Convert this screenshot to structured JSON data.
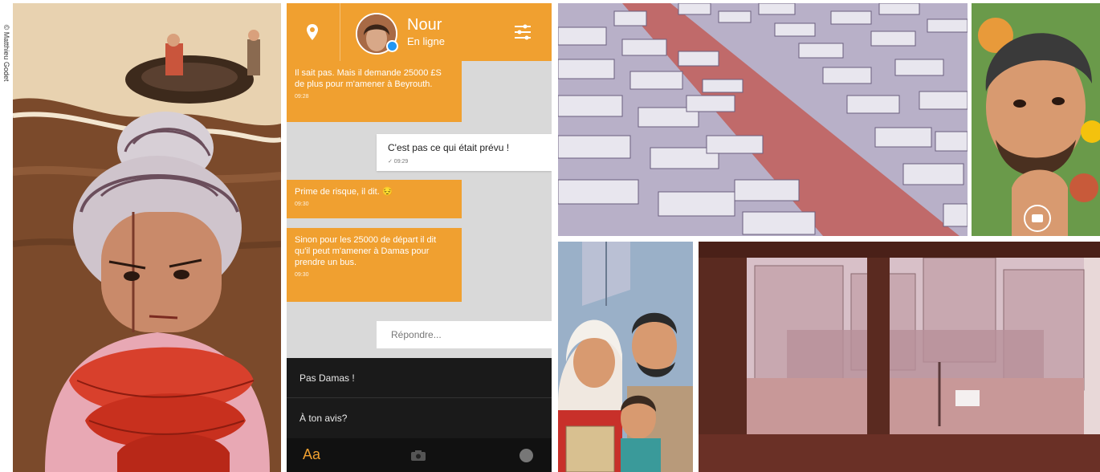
{
  "credit": "© Matthieu Godet",
  "chat": {
    "contact_name": "Nour",
    "contact_status": "En ligne",
    "messages": [
      {
        "text": "Il sait pas. Mais il demande 25000 £S de plus pour m'amener à Beyrouth.",
        "time": "09:28"
      },
      {
        "text": "C'est pas ce qui était prévu !",
        "time": "✓ 09:29"
      },
      {
        "text": "Prime de risque, il dit. 😔",
        "time": "09:30"
      },
      {
        "text": "Sinon pour les 25000 de départ il dit qu'il peut m'amener à Damas pour prendre un bus.",
        "time": "09:30"
      }
    ],
    "reply_placeholder": "Répondre...",
    "quick_replies": [
      "Pas Damas !",
      "À ton avis?"
    ],
    "keyboard_label": "Aa"
  },
  "colors": {
    "accent": "#f0a030",
    "dark": "#1a1a1a"
  }
}
